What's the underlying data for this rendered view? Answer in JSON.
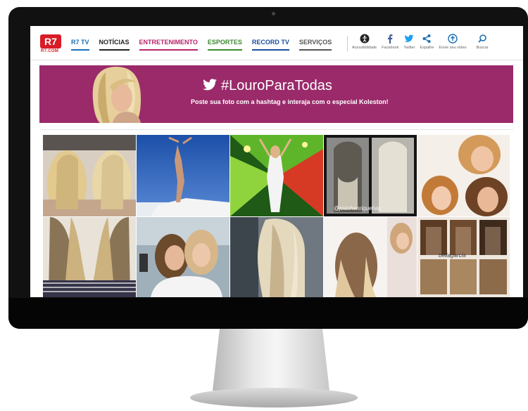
{
  "site": {
    "logo_text": "R7",
    "logo_subtext": "R7.COM"
  },
  "nav": {
    "items": [
      {
        "label": "R7 TV",
        "color": "#1a6fb5"
      },
      {
        "label": "NOTÍCIAS",
        "color": "#222222"
      },
      {
        "label": "ENTRETENIMENTO",
        "color": "#b8246b"
      },
      {
        "label": "ESPORTES",
        "color": "#3c8a2f"
      },
      {
        "label": "RECORD TV",
        "color": "#1a4fa0"
      },
      {
        "label": "SERVIÇOS",
        "color": "#555555"
      }
    ]
  },
  "tools": {
    "accessibility": "Acessibilidade",
    "facebook": "Facebook",
    "twitter": "Twitter",
    "share": "Espalhe",
    "upload": "Envie seu vídeo",
    "search": "Buscar"
  },
  "banner": {
    "hashtag": "#LouroParaTodas",
    "subtitle": "Poste sua foto com a hashtag e interaja com o especial Koleston!",
    "background_color": "#9a2a6a"
  },
  "gallery": {
    "tile_labels": {
      "tile_4": "@joaohenriquehair",
      "tile_10": "bellagarcia"
    }
  }
}
